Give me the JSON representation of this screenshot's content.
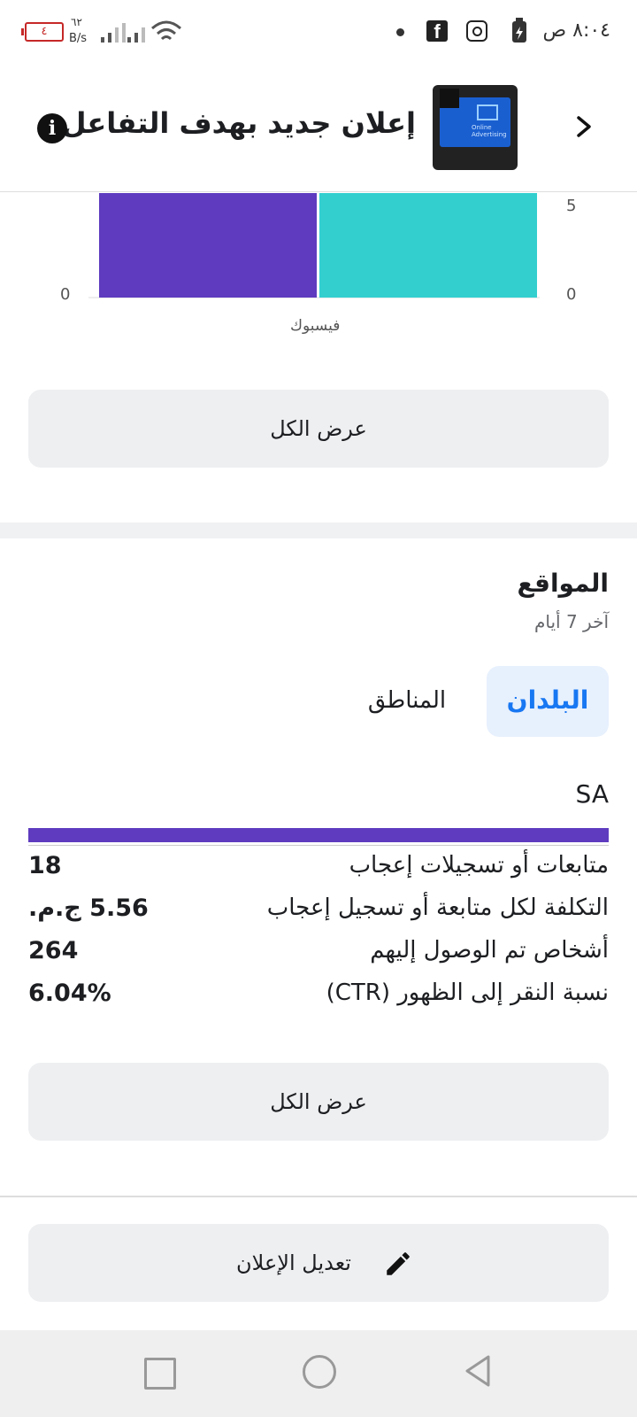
{
  "status_bar": {
    "time": "٨:٠٤ ص",
    "battery_level": "٤",
    "net_speed_value": "٦٢",
    "net_speed_unit": "B/s",
    "icons": [
      "battery-charging-icon",
      "instagram-icon",
      "facebook-icon",
      "dot-icon",
      "wifi-icon",
      "signal-icon",
      "signal-icon",
      "low-battery-icon"
    ]
  },
  "header": {
    "title": "إعلان جديد بهدف التفاعل",
    "thumb_text": "Online Advertising"
  },
  "chart_data": {
    "type": "bar",
    "categories": [
      "فيسبوك"
    ],
    "series": [
      {
        "values": [
          5
        ],
        "color": "#5e3bbf"
      },
      {
        "values": [
          5
        ],
        "color": "#33cfcf"
      }
    ],
    "left_axis_ticks": [
      "0"
    ],
    "right_axis_ticks": [
      "5",
      "0"
    ],
    "note": "Chart is cropped at top; only the lower portion of both bars is visible."
  },
  "buttons": {
    "view_all_1": "عرض الكل",
    "view_all_2": "عرض الكل",
    "edit_ad": "تعديل الإعلان"
  },
  "locations": {
    "title": "المواقع",
    "subtitle": "آخر 7 أيام",
    "tabs": [
      {
        "label": "البلدان",
        "selected": true
      },
      {
        "label": "المناطق",
        "selected": false
      }
    ],
    "country": "SA",
    "bar_fill_fraction": 1.0,
    "metrics": [
      {
        "label": "متابعات أو تسجيلات إعجاب",
        "value": "18"
      },
      {
        "label": "التكلفة لكل متابعة أو تسجيل إعجاب",
        "value": "5.56 ج.م."
      },
      {
        "label": "أشخاص تم الوصول إليهم",
        "value": "264"
      },
      {
        "label": "نسبة النقر إلى الظهور (CTR)",
        "value": "6.04%"
      }
    ]
  },
  "colors": {
    "accent_blue": "#1877f2",
    "bar_purple": "#5e3bbf",
    "bar_teal": "#33cfcf"
  }
}
